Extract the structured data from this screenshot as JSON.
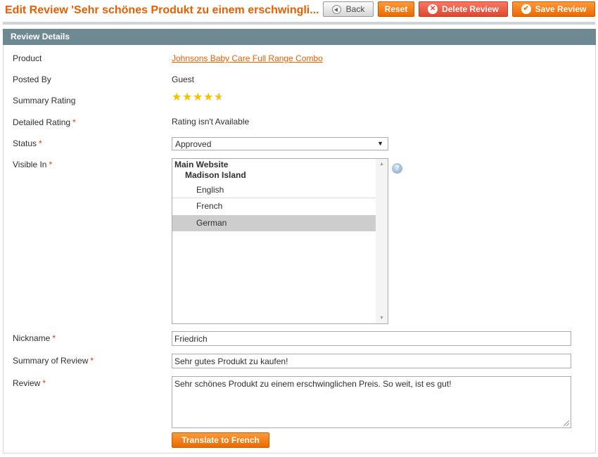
{
  "header": {
    "title": "Edit Review 'Sehr schönes Produkt zu einem erschwingli...",
    "buttons": {
      "back": "Back",
      "reset": "Reset",
      "delete": "Delete Review",
      "save": "Save Review"
    }
  },
  "section": {
    "title": "Review Details"
  },
  "form": {
    "product": {
      "label": "Product",
      "value": "Johnsons Baby Care Full Range Combo"
    },
    "posted_by": {
      "label": "Posted By",
      "value": "Guest"
    },
    "summary_rating": {
      "label": "Summary Rating",
      "value": 4.5,
      "max": 5
    },
    "detailed_rating": {
      "label": "Detailed Rating",
      "required": "*",
      "value": "Rating isn't Available"
    },
    "status": {
      "label": "Status",
      "required": "*",
      "value": "Approved"
    },
    "visible_in": {
      "label": "Visible In",
      "required": "*",
      "website": "Main Website",
      "store": "Madison Island",
      "views": [
        "English",
        "French",
        "German"
      ],
      "selected": "German"
    },
    "nickname": {
      "label": "Nickname",
      "required": "*",
      "value": "Friedrich"
    },
    "summary_of_review": {
      "label": "Summary of Review",
      "required": "*",
      "value": "Sehr gutes Produkt zu kaufen!"
    },
    "review": {
      "label": "Review",
      "required": "*",
      "value": "Sehr schönes Produkt zu einem erschwinglichen Preis. So weit, ist es gut!"
    },
    "translate_button": "Translate to French"
  },
  "colors": {
    "accent": "#eb5e00",
    "section_header": "#6f8992",
    "delete_button": "#e0472e",
    "required": "#eb340a"
  }
}
